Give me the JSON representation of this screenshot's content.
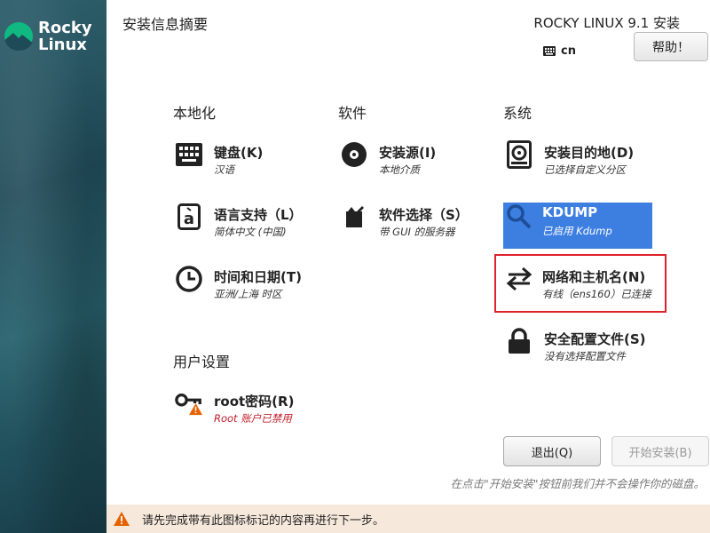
{
  "brand": {
    "line1": "Rocky",
    "line2": "Linux"
  },
  "header": {
    "title": "安装信息摘要",
    "product": "ROCKY LINUX 9.1 安装",
    "keyboard_layout": "cn",
    "help_label": "帮助！"
  },
  "categories": {
    "localization": "本地化",
    "software": "软件",
    "system": "系统",
    "user_settings": "用户设置"
  },
  "spokes": {
    "keyboard": {
      "title": "键盘(K)",
      "status": "汉语",
      "icon": "keyboard-icon"
    },
    "language": {
      "title": "语言支持（L）",
      "status": "简体中文 (中国)",
      "icon": "language-icon"
    },
    "time": {
      "title": "时间和日期(T)",
      "status": "亚洲/上海 时区",
      "icon": "clock-icon"
    },
    "source": {
      "title": "安装源(I)",
      "status": "本地介质",
      "icon": "disc-icon"
    },
    "software": {
      "title": "软件选择（S）",
      "status": "带 GUI 的服务器",
      "icon": "package-icon"
    },
    "destination": {
      "title": "安装目的地(D)",
      "status": "已选择自定义分区",
      "icon": "harddisk-icon"
    },
    "kdump": {
      "title": "KDUMP",
      "status": "已启用 Kdump",
      "icon": "search-icon"
    },
    "network": {
      "title": "网络和主机名(N)",
      "status": "有线（ens160）已连接",
      "icon": "network-arrows-icon"
    },
    "security": {
      "title": "安全配置文件(S)",
      "status": "没有选择配置文件",
      "icon": "lock-icon"
    },
    "root": {
      "title": "root密码(R)",
      "status": "Root 账户已禁用",
      "icon": "key-warning-icon"
    }
  },
  "actions": {
    "quit": "退出(Q)",
    "begin": "开始安装(B)",
    "note": "在点击\"开始安装\"按钮前我们并不会操作你的磁盘。"
  },
  "warning_bar": {
    "text": "请先完成带有此图标标记的内容再进行下一步。"
  },
  "colors": {
    "selected": "#3d7fe0",
    "highlight_border": "#e0202a",
    "warning_text": "#c01c28",
    "warning_bar_bg": "#f6e9dc",
    "warning_icon": "#e66100"
  }
}
